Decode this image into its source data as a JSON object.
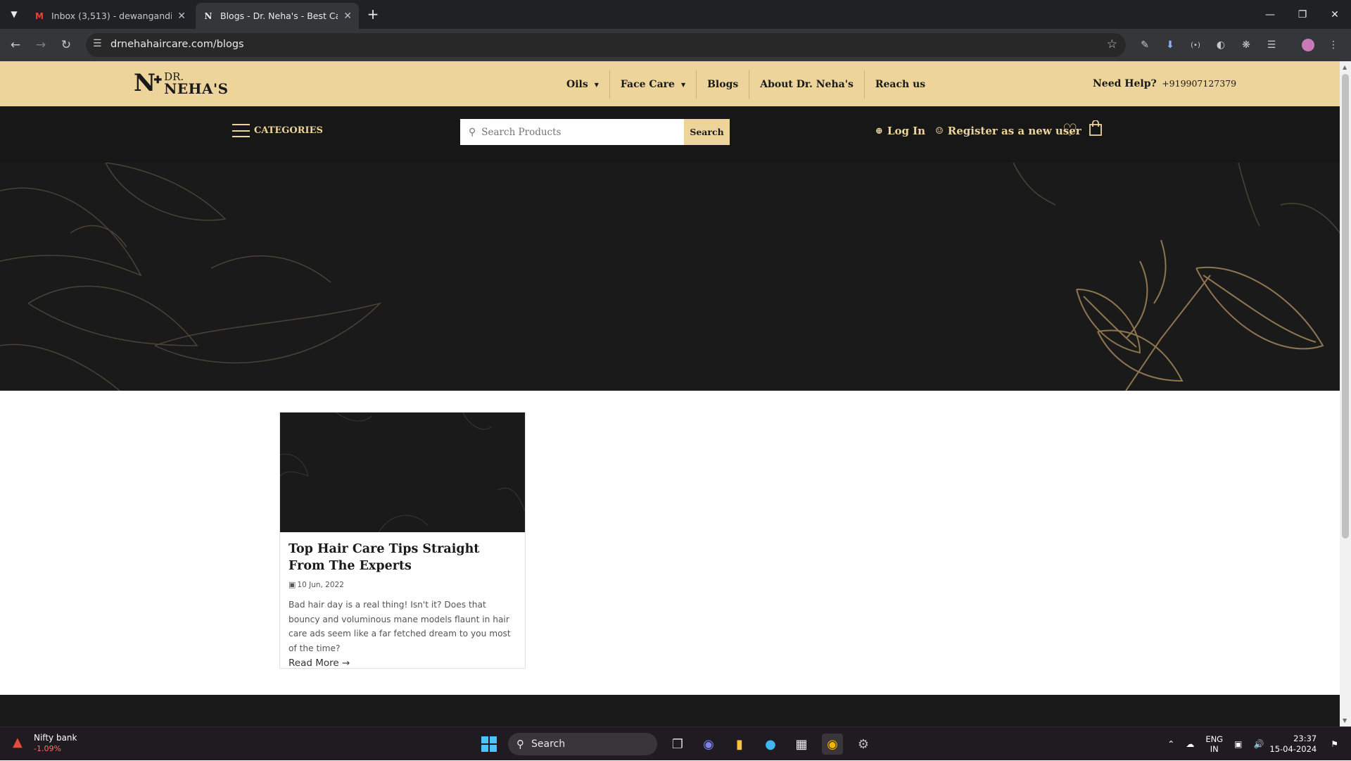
{
  "browser": {
    "tabs": [
      {
        "title": "Inbox (3,513) - dewangandipen",
        "favicon": "gmail-icon",
        "active": false
      },
      {
        "title": "Blogs - Dr. Neha's - Best Care P",
        "favicon": "drneha-icon",
        "active": true
      }
    ],
    "url": "drnehahaircare.com/blogs"
  },
  "site": {
    "logo": {
      "mark": "N",
      "dr": "DR.",
      "name": "NEHA'S"
    },
    "nav": [
      {
        "label": "Oils",
        "dropdown": true
      },
      {
        "label": "Face Care",
        "dropdown": true
      },
      {
        "label": "Blogs",
        "dropdown": false
      },
      {
        "label": "About Dr. Neha's",
        "dropdown": false
      },
      {
        "label": "Reach us",
        "dropdown": false
      }
    ],
    "help": {
      "label": "Need Help?",
      "phone": "+919907127379"
    },
    "categories_label": "CATEGORIES",
    "search": {
      "placeholder": "Search Products",
      "button": "Search"
    },
    "account": {
      "login": "Log In",
      "register": "Register as a new user"
    },
    "colors": {
      "gold": "#ecd49a",
      "dark": "#171717",
      "hero": "#1b1a1a"
    }
  },
  "blog_card": {
    "title": "Top Hair Care Tips Straight From The Experts",
    "date": "10 Jun, 2022",
    "excerpt": "Bad hair day is a real thing! Isn't it? Does that bouncy and voluminous mane models flaunt in hair care ads seem like a far fetched dream to you most of the time?",
    "read_more": "Read More →"
  },
  "taskbar": {
    "widget": {
      "name": "Nifty bank",
      "change": "-1.09%"
    },
    "search_label": "Search",
    "lang": {
      "line1": "ENG",
      "line2": "IN"
    },
    "clock": {
      "time": "23:37",
      "date": "15-04-2024"
    }
  }
}
